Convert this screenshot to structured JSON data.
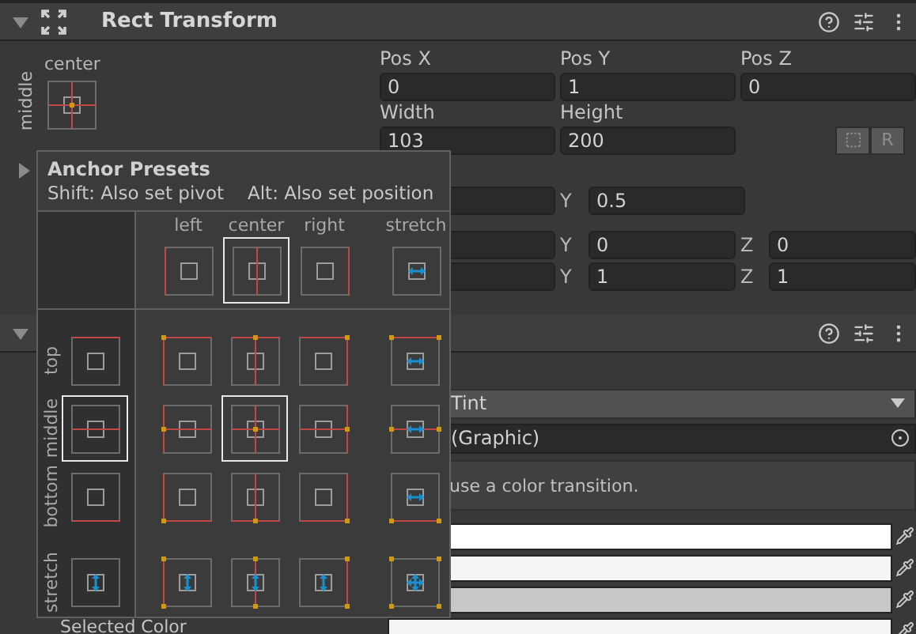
{
  "rect_transform": {
    "title": "Rect Transform",
    "expanded": true,
    "anchor_widget": {
      "horizontal": "center",
      "vertical": "middle"
    },
    "field_rows": [
      {
        "labels": [
          "Pos X",
          "Pos Y",
          "Pos Z"
        ],
        "values": [
          "0",
          "1",
          "0"
        ]
      },
      {
        "labels": [
          "Width",
          "Height"
        ],
        "values": [
          "103",
          "200"
        ]
      }
    ],
    "blueprint_button": {
      "label": "R"
    },
    "anchors_foldout": {
      "expanded": false
    },
    "pivot": {
      "axis": "Y",
      "value": "0.5"
    },
    "vector_rows": [
      {
        "axes": [
          "Y",
          "Z"
        ],
        "values": [
          "0",
          "0"
        ]
      },
      {
        "axes": [
          "Y",
          "Z"
        ],
        "values": [
          "1",
          "1"
        ]
      }
    ]
  },
  "button_component": {
    "expanded": true,
    "transition": "Tint",
    "target_graphic": "(Graphic)",
    "help_text": "use a color transition.",
    "color_fields": [
      {
        "color": "#ffffff"
      },
      {
        "color": "#f5f5f5"
      },
      {
        "color": "#c8c8c8"
      },
      {
        "color": "#f5f5f5"
      }
    ],
    "last_label": "Selected Color"
  },
  "anchor_presets": {
    "title": "Anchor Presets",
    "hints": [
      "Shift: Also set pivot",
      "Alt: Also set position"
    ],
    "columns": [
      {
        "label": "left",
        "kind": "min",
        "selected": false
      },
      {
        "label": "center",
        "kind": "mid",
        "selected": true
      },
      {
        "label": "right",
        "kind": "max",
        "selected": false
      },
      {
        "label": "stretch",
        "kind": "stretch",
        "selected": false
      }
    ],
    "rows": [
      {
        "label": "top",
        "kind": "min",
        "selected": false,
        "cells": [
          {
            "selected": false
          },
          {
            "selected": false
          },
          {
            "selected": false
          },
          {
            "selected": false
          }
        ]
      },
      {
        "label": "middle",
        "kind": "mid",
        "selected": true,
        "cells": [
          {
            "selected": false
          },
          {
            "selected": true
          },
          {
            "selected": false
          },
          {
            "selected": false
          }
        ]
      },
      {
        "label": "bottom",
        "kind": "max",
        "selected": false,
        "cells": [
          {
            "selected": false
          },
          {
            "selected": false
          },
          {
            "selected": false
          },
          {
            "selected": false
          }
        ]
      },
      {
        "label": "stretch",
        "kind": "stretch",
        "selected": false,
        "cells": [
          {
            "selected": false
          },
          {
            "selected": false
          },
          {
            "selected": false
          },
          {
            "selected": false
          }
        ]
      }
    ]
  }
}
